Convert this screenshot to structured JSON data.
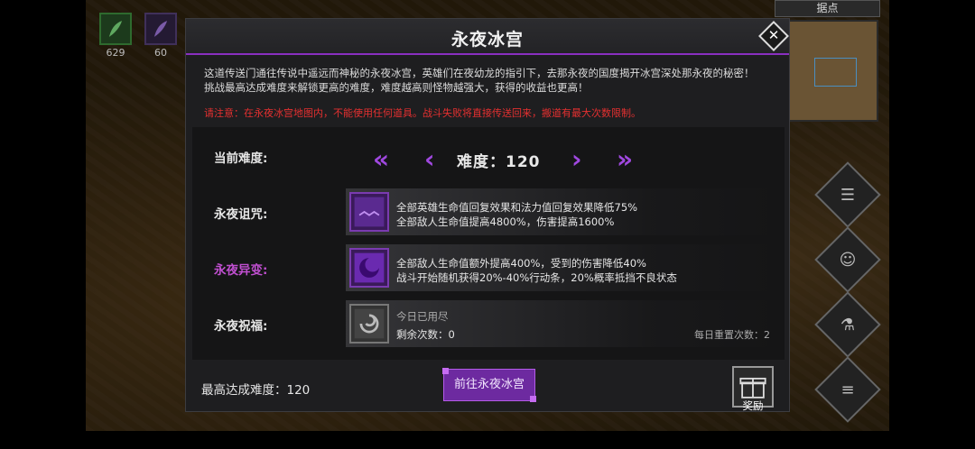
{
  "hud": {
    "resource1_count": "629",
    "resource2_count": "60",
    "minimap_tab": "据点"
  },
  "dialog": {
    "title": "永夜冰宫",
    "intro_line1": "这道传送门通往传说中遥远而神秘的永夜冰宫，英雄们在夜幼龙的指引下，去那永夜的国度揭开冰宫深处那永夜的秘密！",
    "intro_line2": "挑战最高达成难度来解锁更高的难度，难度越高则怪物越强大，获得的收益也更高！",
    "warning": "请注意：在永夜冰宫地图内，不能使用任何道具。战斗失败将直接传送回来，搬道有最大次数限制。",
    "difficulty": {
      "label": "当前难度:",
      "text": "难度：120"
    },
    "curse": {
      "label": "永夜诅咒:",
      "line1": "全部英雄生命值回复效果和法力值回复效果降低75%",
      "line2": "全部敌人生命值提高4800%，伤害提高1600%"
    },
    "mutation": {
      "label": "永夜异变:",
      "line1": "全部敌人生命值额外提高400%，受到的伤害降低40%",
      "line2": "战斗开始随机获得20%-40%行动条，20%概率抵挡不良状态"
    },
    "blessing": {
      "label": "永夜祝福:",
      "line1": "今日已用尽",
      "line2": "剩余次数：0",
      "reset": "每日重置次数：2"
    },
    "max_difficulty": "最高达成难度：120",
    "go_button": "前往永夜冰宫",
    "reward_label": "奖励"
  },
  "colors": {
    "accent_purple": "#a048e0",
    "warning_red": "#e53030",
    "mutation_label": "#c04fd0"
  }
}
